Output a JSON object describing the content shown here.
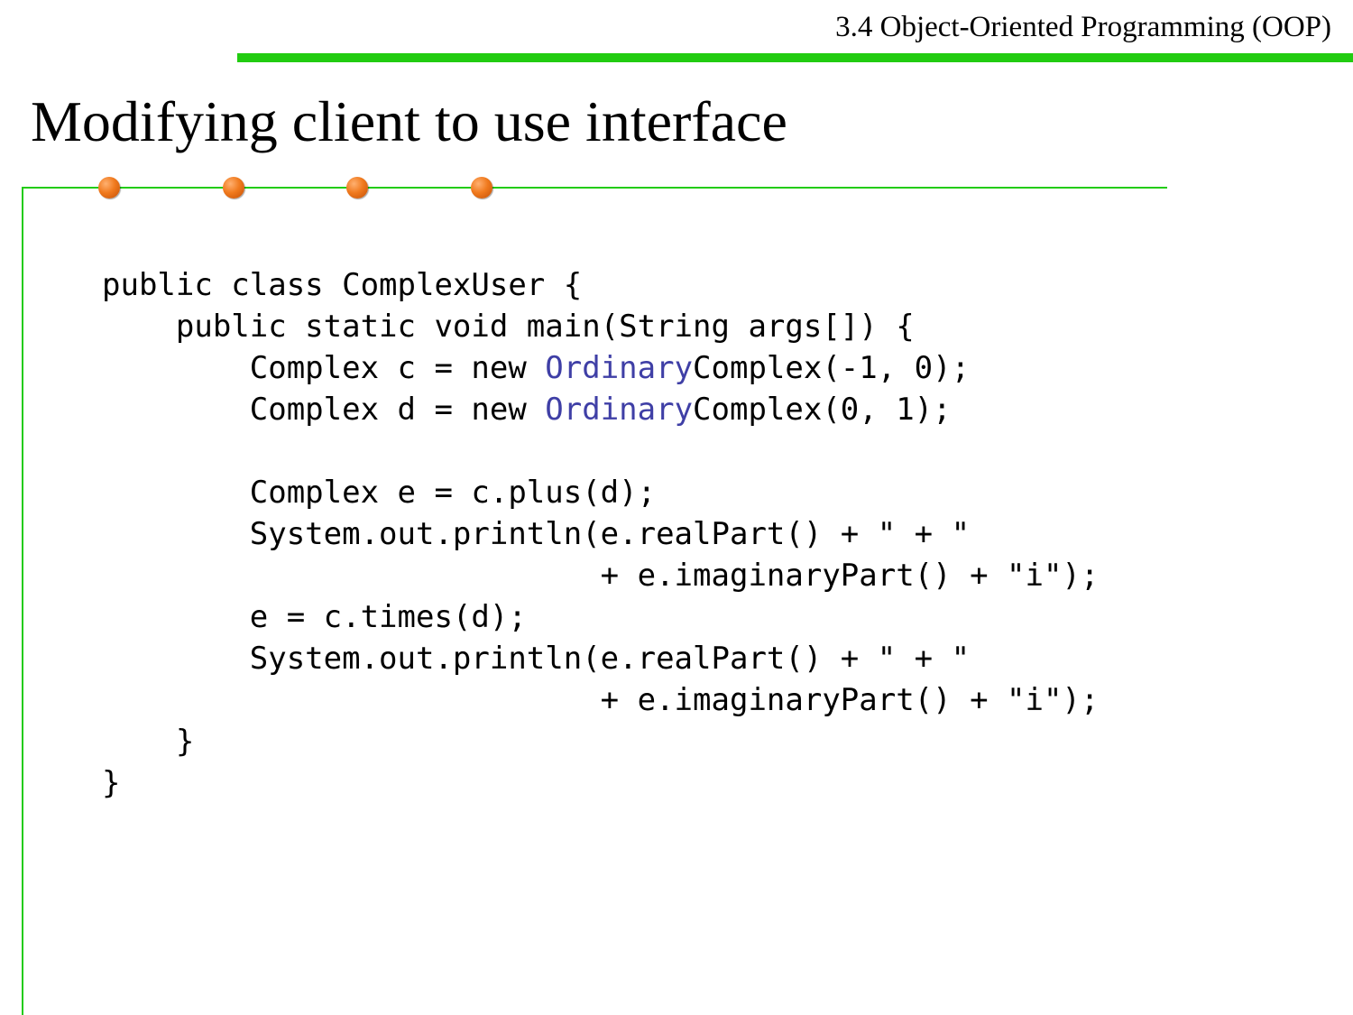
{
  "header": {
    "section_label": "3.4 Object-Oriented Programming (OOP)"
  },
  "slide": {
    "title": "Modifying client to use interface"
  },
  "colors": {
    "accent_green": "#22cc11",
    "dot_orange": "#f07a1e",
    "highlight_blue": "#3f3fa6"
  },
  "decorations": {
    "dot_count": 4
  },
  "code": {
    "lines": [
      "public class ComplexUser {",
      "    public static void main(String args[]) {",
      {
        "pre": "        Complex c = new ",
        "hl": "Ordinary",
        "post": "Complex(-1, 0);"
      },
      {
        "pre": "        Complex d = new ",
        "hl": "Ordinary",
        "post": "Complex(0, 1);"
      },
      "",
      "        Complex e = c.plus(d);",
      "        System.out.println(e.realPart() + \" + \"",
      "                           + e.imaginaryPart() + \"i\");",
      "        e = c.times(d);",
      "        System.out.println(e.realPart() + \" + \"",
      "                           + e.imaginaryPart() + \"i\");",
      "    }",
      "}"
    ]
  }
}
